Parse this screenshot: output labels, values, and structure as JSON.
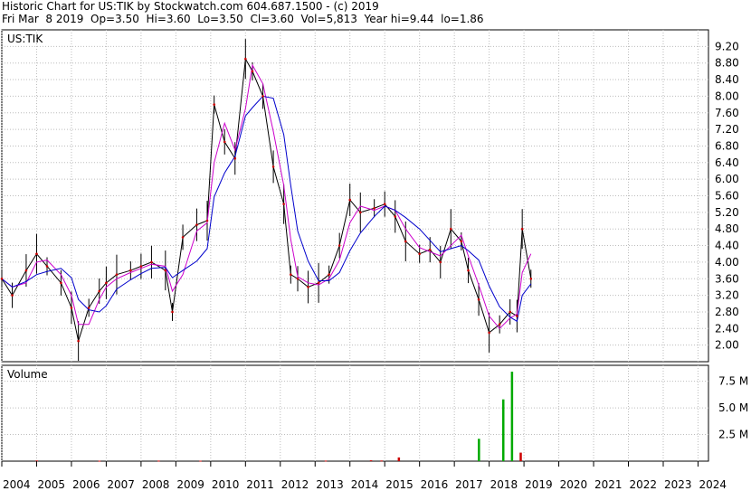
{
  "header": {
    "line1": "Historic Chart for US:TIK by Stockwatch.com 604.687.1500 - (c) 2019",
    "line2": "Fri Mar  8 2019  Op=3.50  Hi=3.60  Lo=3.50  Cl=3.60  Vol=5,813  Year hi=9.44  lo=1.86"
  },
  "chart_data": [
    {
      "type": "line",
      "panel_label": "US:TIK",
      "ylim": [
        1.6,
        9.6
      ],
      "y_ticks": [
        "9.20",
        "8.80",
        "8.40",
        "8.00",
        "7.60",
        "7.20",
        "6.80",
        "6.40",
        "6.00",
        "5.60",
        "5.20",
        "4.80",
        "4.40",
        "4.00",
        "3.60",
        "3.20",
        "2.80",
        "2.40",
        "2.00"
      ],
      "x_ticks": [
        "2004",
        "2005",
        "2006",
        "2007",
        "2008",
        "2009",
        "2010",
        "2011",
        "2012",
        "2013",
        "2014",
        "2015",
        "2016",
        "2017",
        "2018",
        "2019",
        "2020",
        "2021",
        "2022",
        "2023",
        "2024"
      ],
      "grid": true,
      "colors": {
        "price": "#000000",
        "close_dots": "#cc0000",
        "ma_short": "#cc00cc",
        "ma_long": "#0000cc"
      },
      "series": [
        {
          "x": [
            2004.0,
            2004.3,
            2004.7,
            2005.0,
            2005.3,
            2005.7,
            2006.0,
            2006.2,
            2006.5,
            2006.8,
            2007.0,
            2007.3,
            2007.7,
            2008.0,
            2008.3,
            2008.7,
            2008.9,
            2009.2,
            2009.6,
            2009.9,
            2010.1,
            2010.4,
            2010.7,
            2011.0,
            2011.2,
            2011.5,
            2011.8,
            2012.1,
            2012.3,
            2012.5,
            2012.8,
            2013.1,
            2013.4,
            2013.7,
            2014.0,
            2014.3,
            2014.7,
            2015.0,
            2015.3,
            2015.6,
            2016.0,
            2016.3,
            2016.6,
            2016.9,
            2017.2,
            2017.4,
            2017.7,
            2018.0,
            2018.3,
            2018.6,
            2018.8,
            2018.95,
            2019.2
          ],
          "values": [
            3.6,
            3.2,
            3.8,
            4.2,
            3.9,
            3.5,
            2.9,
            2.1,
            2.9,
            3.3,
            3.5,
            3.7,
            3.8,
            3.9,
            4.0,
            3.8,
            2.8,
            4.6,
            4.9,
            5.0,
            7.8,
            6.9,
            6.5,
            8.9,
            8.6,
            8.0,
            6.3,
            5.4,
            3.7,
            3.6,
            3.4,
            3.5,
            3.7,
            4.4,
            5.5,
            5.2,
            5.3,
            5.4,
            5.1,
            4.5,
            4.2,
            4.3,
            4.0,
            4.8,
            4.5,
            3.8,
            3.1,
            2.3,
            2.5,
            2.8,
            2.7,
            4.8,
            3.6
          ]
        }
      ]
    },
    {
      "type": "bar",
      "panel_label": "Volume",
      "ylim": [
        0,
        9000000
      ],
      "y_ticks": [
        "7.5 M",
        "5.0 M",
        "2.5 M"
      ],
      "series": [
        {
          "x": [
            2005.0,
            2006.8,
            2008.5,
            2009.7,
            2013.3,
            2014.6,
            2014.9,
            2015.4,
            2017.7,
            2018.4,
            2018.65,
            2018.9
          ],
          "values": [
            60000,
            40000,
            50000,
            40000,
            50000,
            80000,
            60000,
            350000,
            2100000,
            5800000,
            8400000,
            800000
          ]
        }
      ]
    }
  ]
}
